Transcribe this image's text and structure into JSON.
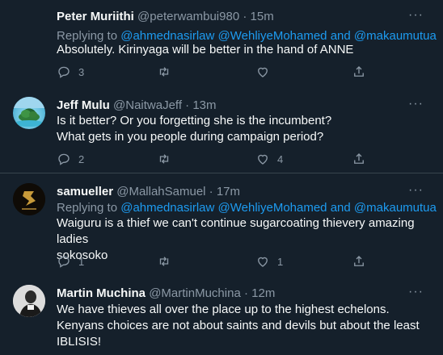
{
  "tweets": [
    {
      "name": "Peter Muriithi",
      "handle": "@peterwambui980",
      "time": "· 15m",
      "replying_prefix": "Replying to",
      "replying_to": [
        "@ahmednasirlaw",
        "@WehliyeMohamed",
        "and",
        "@makaumutua"
      ],
      "text": "Absolutely. Kirinyaga will be better in the hand of ANNE",
      "replies": "3",
      "retweets": "",
      "likes": ""
    },
    {
      "name": "Jeff Mulu",
      "handle": "@NaitwaJeff",
      "time": "· 13m",
      "text_lines": [
        "Is it better? Or you forgetting she is the incumbent?",
        "What gets in you people during campaign period?"
      ],
      "replies": "2",
      "retweets": "",
      "likes": "4"
    },
    {
      "name": "samueller",
      "handle": "@MallahSamuel",
      "time": "· 17m",
      "replying_prefix": "Replying to",
      "replying_to": [
        "@ahmednasirlaw",
        "@WehliyeMohamed",
        "and",
        "@makaumutua"
      ],
      "text_lines": [
        "Waiguru is a thief we can't continue sugarcoating thievery amazing ladies",
        "sokosoko"
      ],
      "replies": "1",
      "retweets": "",
      "likes": "1"
    },
    {
      "name": "Martin Muchina",
      "handle": "@MartinMuchina",
      "time": "· 12m",
      "text_lines": [
        "We have thieves all over the place up to the highest echelons.",
        "Kenyans choices are not about saints and devils but about the least",
        "IBLISIS!"
      ]
    }
  ],
  "colors": {
    "background": "#15202b",
    "text": "#f7f9f9",
    "muted": "#8b98a5",
    "link": "#1d9bf0",
    "border": "#38444d"
  },
  "icons": [
    "more-icon",
    "reply-icon",
    "retweet-icon",
    "like-icon",
    "share-icon"
  ]
}
